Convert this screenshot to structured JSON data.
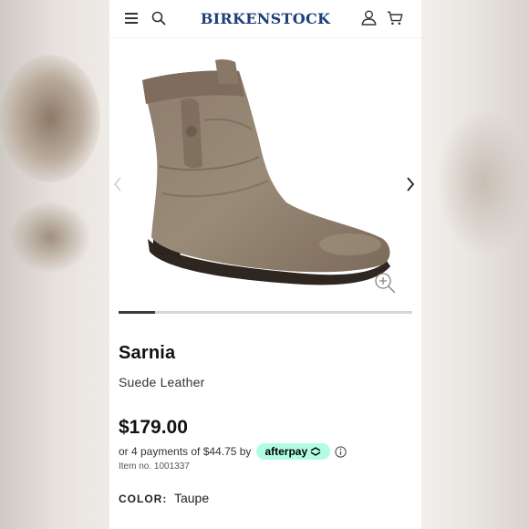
{
  "header": {
    "logo_text": "BIRKENSTOCK",
    "icons": [
      "hamburger-menu-icon",
      "search-icon",
      "account-icon",
      "cart-icon"
    ]
  },
  "gallery": {
    "image_alt": "Sarnia boot",
    "progress_fraction": 0.125,
    "icons": [
      "chevron-left-icon",
      "chevron-right-icon",
      "zoom-in-icon"
    ]
  },
  "product": {
    "name": "Sarnia",
    "material": "Suede Leather",
    "price": "$179.00",
    "installments_text": "or 4 payments of $44.75 by",
    "afterpay_label": "afterpay",
    "item_number": "Item no. 1001337",
    "color_label": "COLOR:",
    "color_value": "Taupe"
  },
  "colors": {
    "brand": "#1d3f7a",
    "afterpay": "#b2fce4",
    "boot": "#8b7a68",
    "sole": "#2e2620"
  }
}
